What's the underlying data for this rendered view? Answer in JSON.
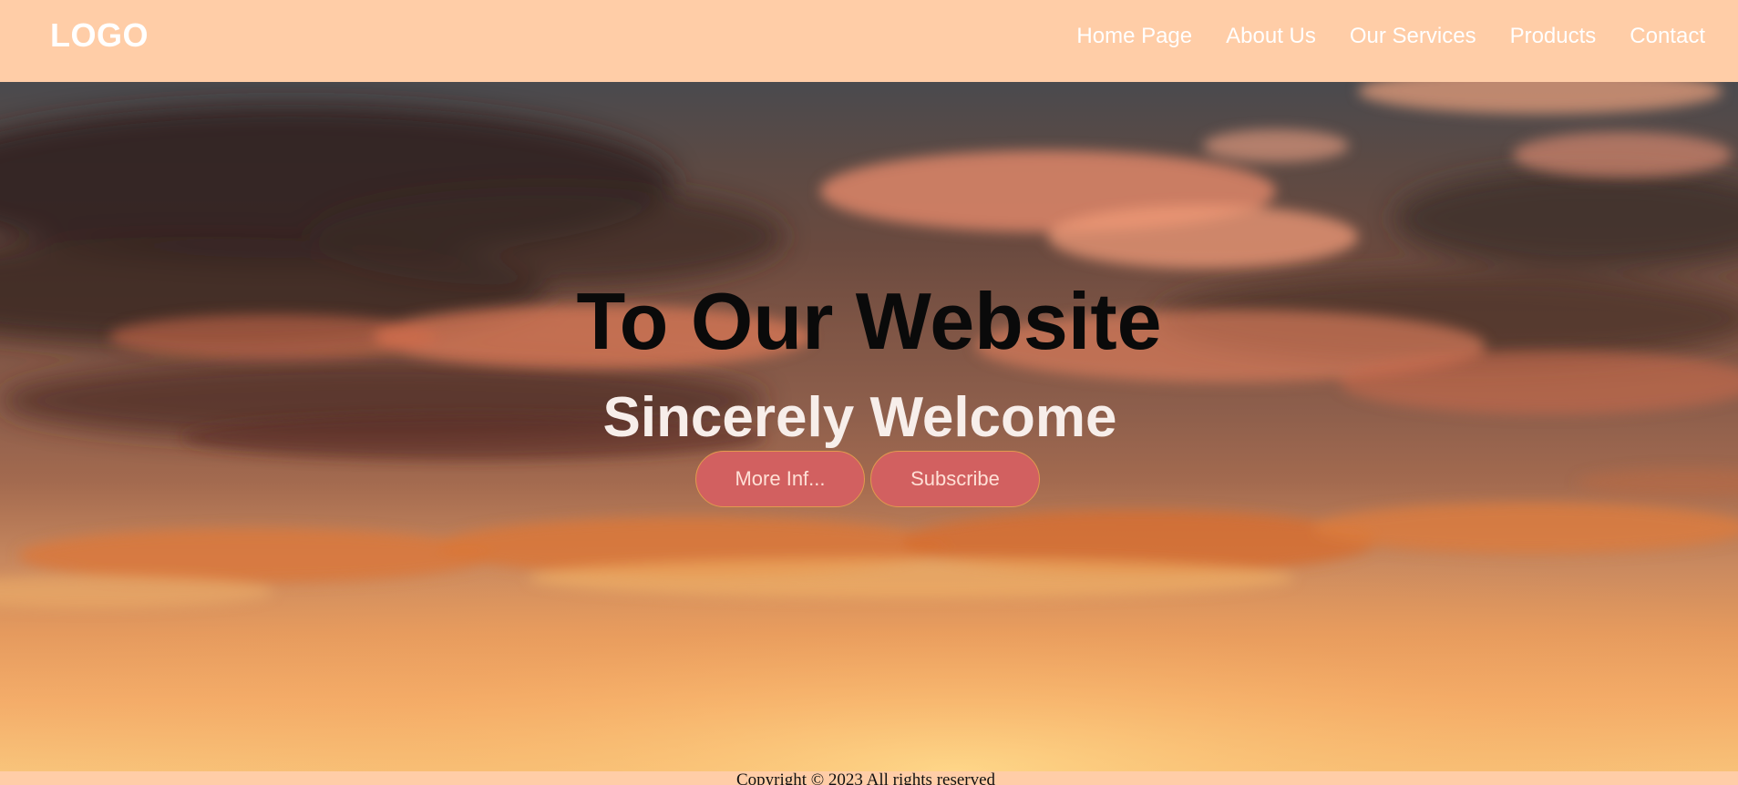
{
  "header": {
    "logo": "LOGO",
    "nav": [
      {
        "label": "Home Page"
      },
      {
        "label": "About Us"
      },
      {
        "label": "Our Services"
      },
      {
        "label": "Products"
      },
      {
        "label": "Contact"
      }
    ]
  },
  "hero": {
    "title": "To Our Website",
    "subtitle": "Sincerely Welcome",
    "buttons": [
      {
        "label": "More Inf..."
      },
      {
        "label": "Subscribe"
      }
    ],
    "background": "sunset sky with clouds"
  },
  "footer": {
    "copyright": "Copyright © 2023 All rights reserved"
  },
  "colors": {
    "header_bg": "#ffcda7",
    "button_bg": "#d26060",
    "button_border": "#e29a4e",
    "title": "#0a0a0a",
    "subtitle": "#f7eeea"
  }
}
